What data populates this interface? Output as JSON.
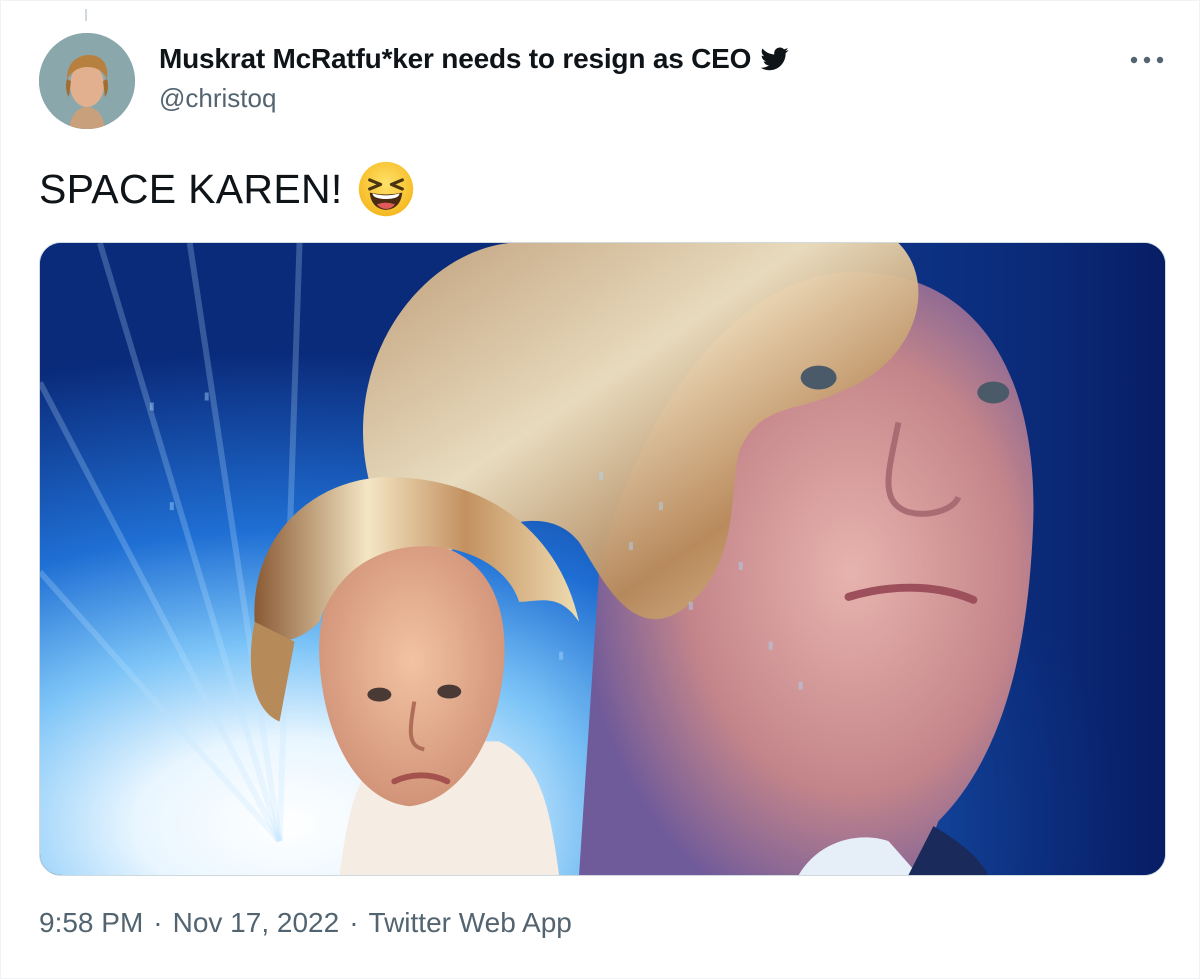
{
  "tweet": {
    "display_name": "Muskrat McRatfu*ker needs to resign as CEO",
    "handle": "@christoq",
    "text": "SPACE KAREN!",
    "emoji": "laughing-emoji",
    "time": "9:58 PM",
    "date": "Nov 17, 2022",
    "source": "Twitter Web App",
    "separator": "·"
  },
  "icons": {
    "bird": "twitter-bird-icon",
    "more": "more-options-icon"
  },
  "colors": {
    "text_primary": "#0f1419",
    "text_secondary": "#536471",
    "twitter_blue": "#1d9bf0",
    "border": "#cfd9de"
  }
}
